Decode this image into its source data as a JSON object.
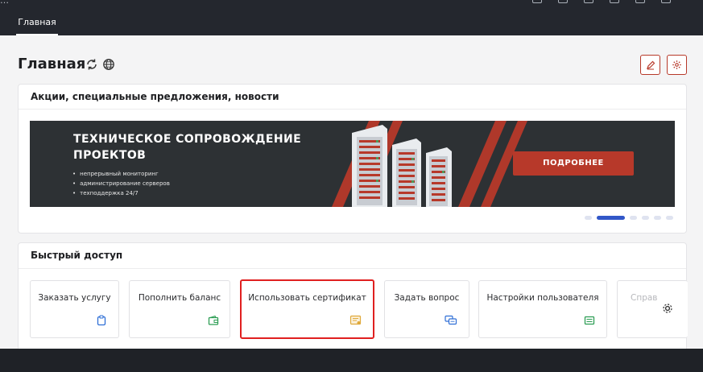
{
  "topbar": {
    "crumb": "…"
  },
  "tabs": [
    {
      "label": "Главная"
    }
  ],
  "page": {
    "title": "Главная"
  },
  "promo": {
    "title": "Акции, специальные предложения, новости",
    "banner": {
      "headline": "ТЕХНИЧЕСКОЕ СОПРОВОЖДЕНИЕ ПРОЕКТОВ",
      "bullets": [
        "непрерывный мониторинг",
        "администрирование серверов",
        "техподдержка 24/7"
      ],
      "button_label": "ПОДРОБНЕЕ"
    },
    "carousel": {
      "slides": 6,
      "active": 2
    }
  },
  "quick_access": {
    "title": "Быстрый доступ",
    "tiles": [
      {
        "label": "Заказать услугу",
        "icon": "clipboard-icon",
        "color": "#2f6fd6"
      },
      {
        "label": "Пополнить баланс",
        "icon": "wallet-icon",
        "color": "#2e9e55"
      },
      {
        "label": "Использовать сертификат",
        "icon": "certificate-icon",
        "color": "#e0a93a",
        "highlighted": true
      },
      {
        "label": "Задать вопрос",
        "icon": "chat-icon",
        "color": "#2f6fd6"
      },
      {
        "label": "Настройки пользователя",
        "icon": "user-settings-icon",
        "color": "#2e9e55"
      },
      {
        "label": "Справ",
        "icon": "help-icon",
        "color": "#b6b7bb"
      }
    ]
  },
  "colors": {
    "accent": "#b7392a",
    "topbar": "#24272e",
    "highlight": "#e02020",
    "carousel_active": "#3257c8"
  }
}
